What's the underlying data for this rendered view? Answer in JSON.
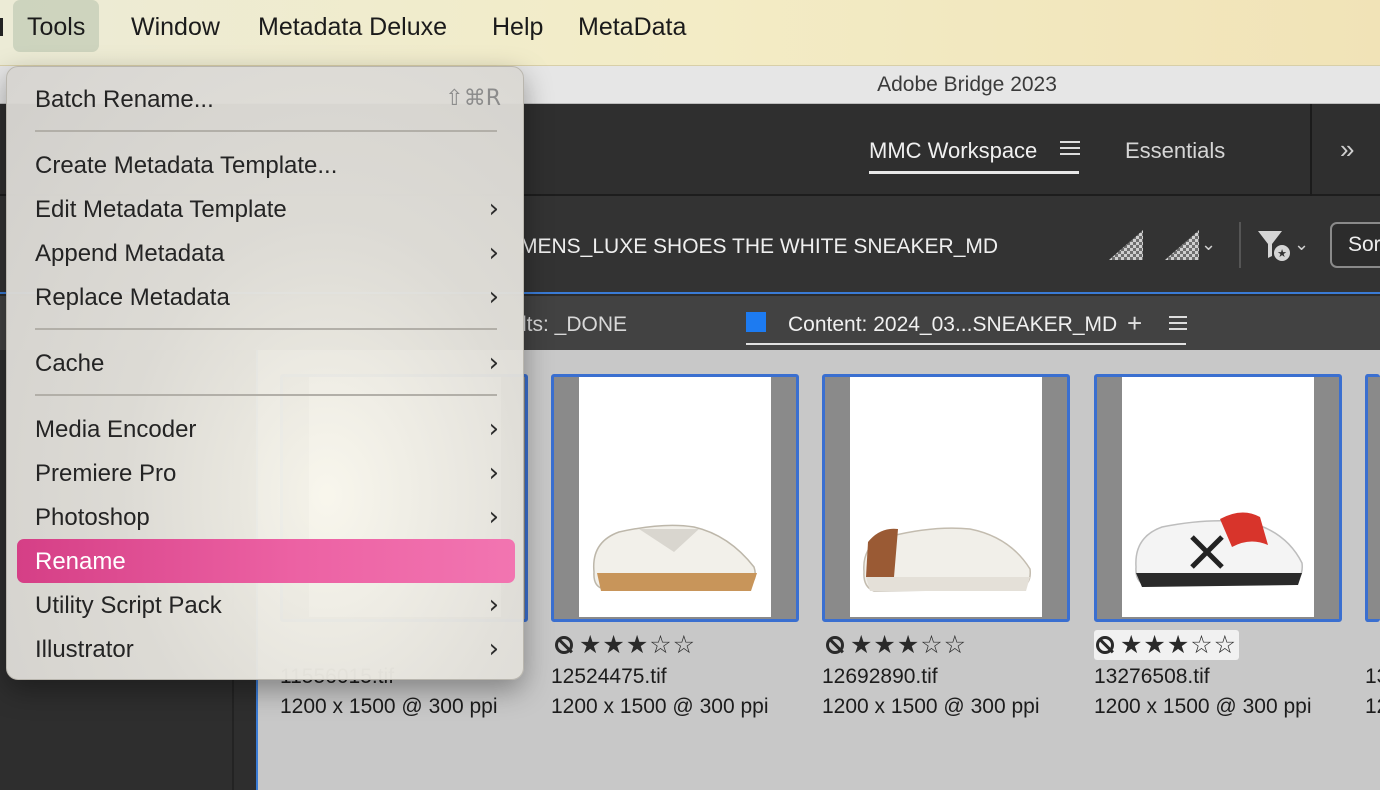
{
  "menubar": {
    "items": [
      {
        "label": "Tools",
        "active": true
      },
      {
        "label": "Window"
      },
      {
        "label": "Metadata Deluxe"
      },
      {
        "label": "Help"
      },
      {
        "label": "MetaData"
      }
    ]
  },
  "window": {
    "title": "Adobe Bridge 2023"
  },
  "workspace": {
    "active": "MMC Workspace",
    "other": "Essentials",
    "more_icon": "double-chevron-right-icon"
  },
  "pathbar": {
    "path": "MENS_LUXE SHOES THE WHITE SNEAKER_MD",
    "sort_label": "Sort"
  },
  "tabs": {
    "left_partial": "lts: _DONE",
    "content_label": "Content: 2024_03...SNEAKER_MD",
    "color": "#1d7bf1"
  },
  "tools_menu": {
    "items": [
      {
        "label": "Batch Rename...",
        "shortcut": "⇧⌘R"
      },
      {
        "label": "Create Metadata Template..."
      },
      {
        "label": "Edit Metadata Template",
        "submenu": true
      },
      {
        "label": "Append Metadata",
        "submenu": true
      },
      {
        "label": "Replace Metadata",
        "submenu": true
      },
      {
        "label": "Cache",
        "submenu": true
      },
      {
        "label": "Media Encoder",
        "submenu": true
      },
      {
        "label": "Premiere Pro",
        "submenu": true
      },
      {
        "label": "Photoshop",
        "submenu": true
      },
      {
        "label": "Rename",
        "selected": true
      },
      {
        "label": "Utility Script Pack",
        "submenu": true
      },
      {
        "label": "Illustrator",
        "submenu": true
      }
    ],
    "selected_color": "#e653a0"
  },
  "thumbnails": [
    {
      "name": "11556015.tif",
      "dims": "1200 x 1500 @ 300 ppi"
    },
    {
      "name": "12524475.tif",
      "dims": "1200 x 1500 @ 300 ppi",
      "rating": 3
    },
    {
      "name": "12692890.tif",
      "dims": "1200 x 1500 @ 300 ppi",
      "rating": 3
    },
    {
      "name": "13276508.tif",
      "dims": "1200 x 1500 @ 300 ppi",
      "rating": 3
    },
    {
      "name": "13",
      "dims": "12"
    }
  ],
  "rating_display": "★★★☆☆"
}
